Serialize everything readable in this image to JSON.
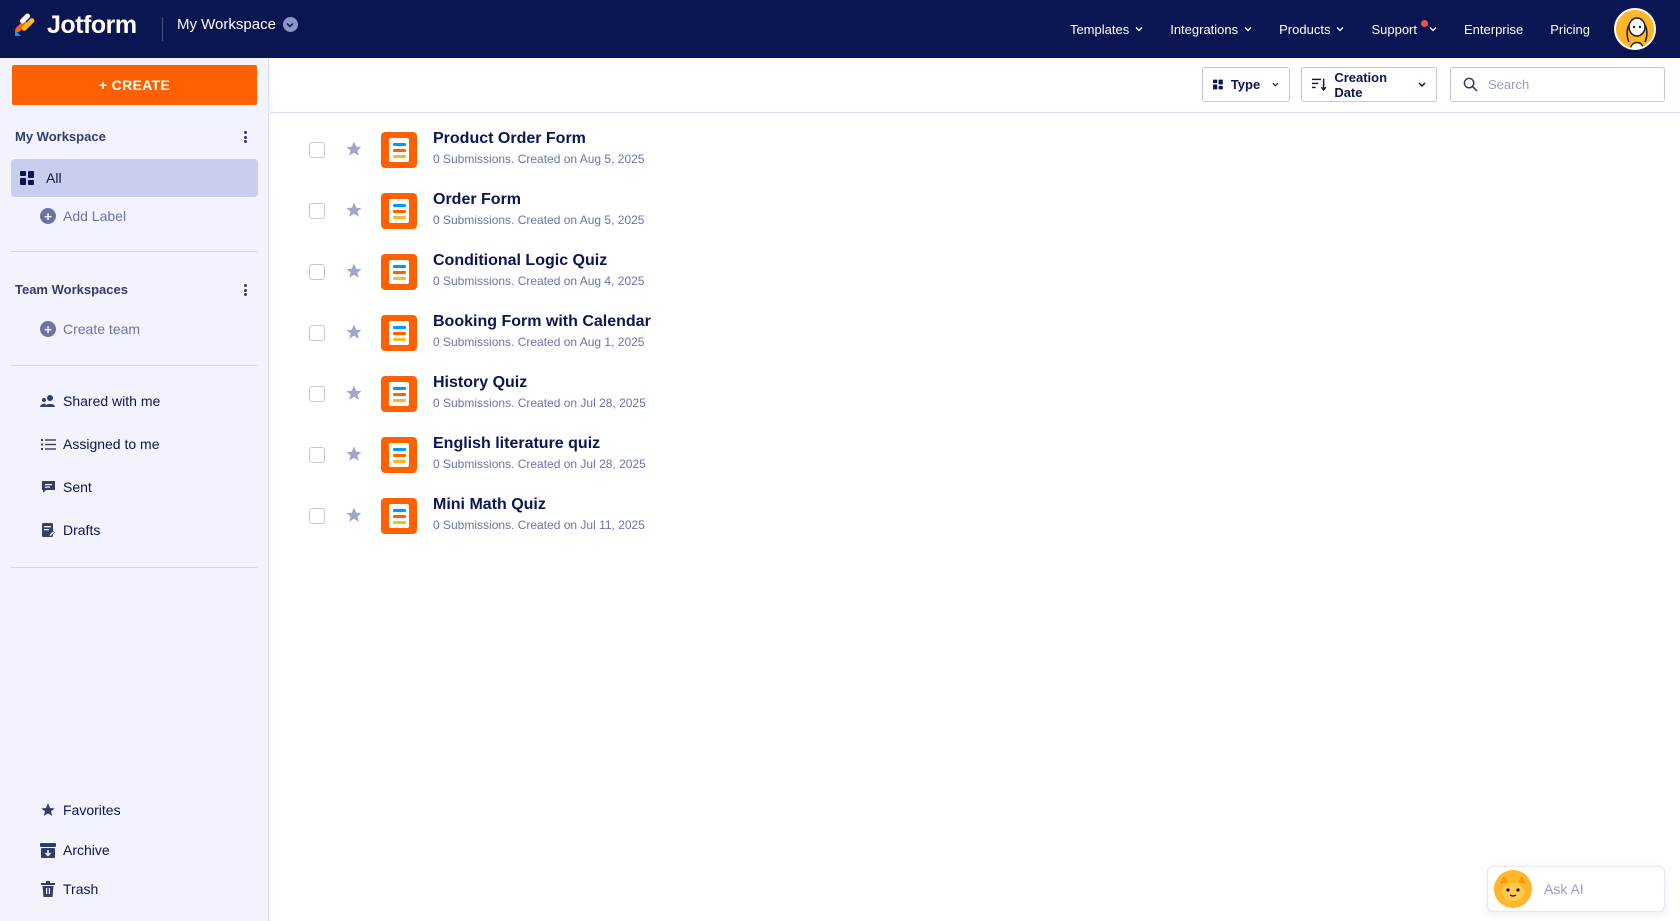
{
  "header": {
    "logo_text": "Jotform",
    "workspace_label": "My Workspace",
    "nav": [
      {
        "label": "Templates"
      },
      {
        "label": "Integrations"
      },
      {
        "label": "Products"
      },
      {
        "label": "Support"
      },
      {
        "label": "Enterprise"
      },
      {
        "label": "Pricing"
      }
    ]
  },
  "sidebar": {
    "create_label": "+ CREATE",
    "my_workspace_title": "My Workspace",
    "all_label": "All",
    "add_label": "Add Label",
    "team_workspaces_title": "Team Workspaces",
    "create_team_label": "Create team",
    "shared_label": "Shared with me",
    "assigned_label": "Assigned to me",
    "sent_label": "Sent",
    "drafts_label": "Drafts",
    "favorites_label": "Favorites",
    "archive_label": "Archive",
    "trash_label": "Trash"
  },
  "toolbar": {
    "type_label": "Type",
    "sort_label": "Creation Date",
    "search_placeholder": "Search"
  },
  "forms": [
    {
      "title": "Product Order Form",
      "meta": "0 Submissions. Created on Aug 5, 2025"
    },
    {
      "title": "Order Form",
      "meta": "0 Submissions. Created on Aug 5, 2025"
    },
    {
      "title": "Conditional Logic Quiz",
      "meta": "0 Submissions. Created on Aug 4, 2025"
    },
    {
      "title": "Booking Form with Calendar",
      "meta": "0 Submissions. Created on Aug 1, 2025"
    },
    {
      "title": "History Quiz",
      "meta": "0 Submissions. Created on Jul 28, 2025"
    },
    {
      "title": "English literature quiz",
      "meta": "0 Submissions. Created on Jul 28, 2025"
    },
    {
      "title": "Mini Math Quiz",
      "meta": "0 Submissions. Created on Jul 11, 2025"
    }
  ],
  "ask_ai": {
    "label": "Ask AI"
  },
  "colors": {
    "navy": "#0a1551",
    "orange": "#ff6100",
    "sidebar_bg": "#f3f3fe",
    "selected_bg": "#c8ceed",
    "muted": "#6c73a8",
    "icon_blue": "#09f",
    "icon_orange": "#ff6100",
    "icon_yellow": "#ffb629"
  }
}
